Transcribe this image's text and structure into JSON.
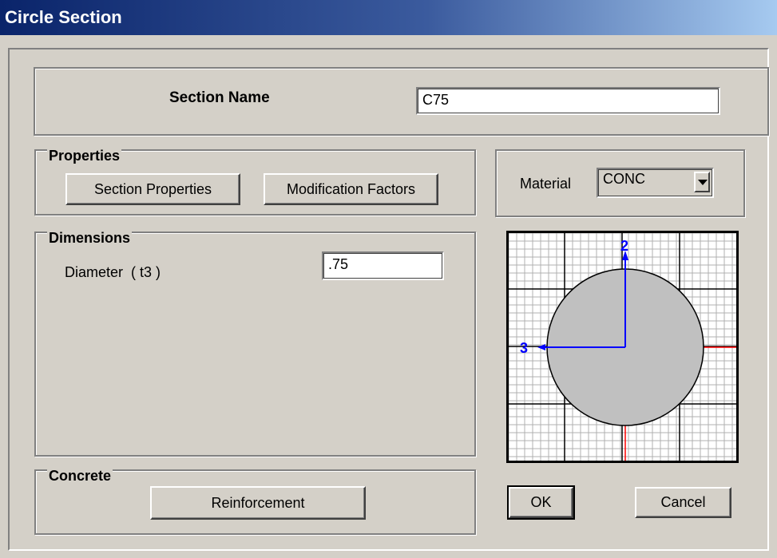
{
  "window": {
    "title": "Circle Section"
  },
  "section_name": {
    "label": "Section Name",
    "value": "C75"
  },
  "properties": {
    "title": "Properties",
    "section_properties_button": "Section Properties",
    "modification_factors_button": "Modification Factors"
  },
  "material": {
    "label": "Material",
    "value": "CONC"
  },
  "dimensions": {
    "title": "Dimensions",
    "diameter_label": "Diameter  ( t3 )",
    "diameter_value": ".75"
  },
  "preview": {
    "axis_2_label": "2",
    "axis_3_label": "3",
    "axis_color": "#0000ff",
    "centerline_color": "#ff0000",
    "section_fill": "#c0c0c0",
    "grid_color": "#b0b0b0"
  },
  "concrete": {
    "title": "Concrete",
    "reinforcement_button": "Reinforcement"
  },
  "footer": {
    "ok_button": "OK",
    "cancel_button": "Cancel"
  }
}
